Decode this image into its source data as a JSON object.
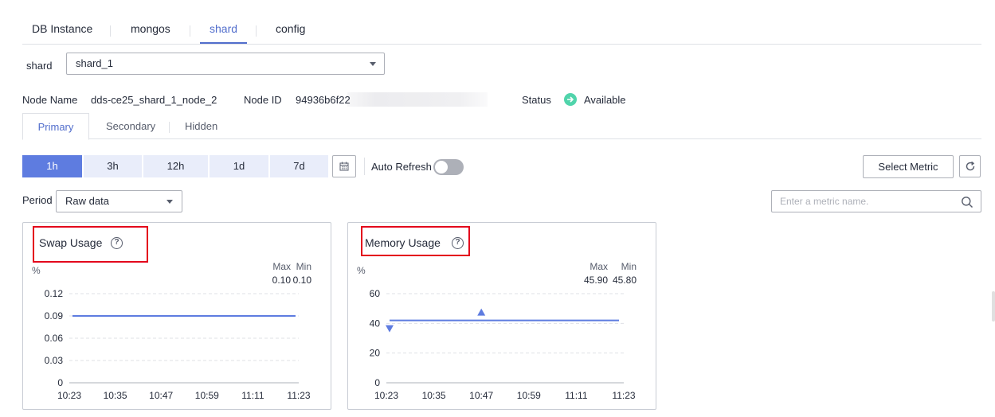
{
  "top_tabs": [
    {
      "label": "DB Instance",
      "active": false
    },
    {
      "label": "mongos",
      "active": false
    },
    {
      "label": "shard",
      "active": true
    },
    {
      "label": "config",
      "active": false
    }
  ],
  "shard_selector": {
    "label": "shard",
    "value": "shard_1"
  },
  "node_info": {
    "name_label": "Node Name",
    "name_value": "dds-ce25_shard_1_node_2",
    "id_label": "Node ID",
    "id_value": "94936b6f22",
    "status_label": "Status",
    "status_value": "Available",
    "status_color": "#50d4ab"
  },
  "sub_tabs": [
    {
      "label": "Primary",
      "active": true
    },
    {
      "label": "Secondary",
      "active": false
    },
    {
      "label": "Hidden",
      "active": false
    }
  ],
  "time_ranges": [
    {
      "label": "1h",
      "active": true
    },
    {
      "label": "3h",
      "active": false
    },
    {
      "label": "12h",
      "active": false
    },
    {
      "label": "1d",
      "active": false
    },
    {
      "label": "7d",
      "active": false
    }
  ],
  "auto_refresh": {
    "label": "Auto Refresh",
    "enabled": false
  },
  "select_metric_label": "Select Metric",
  "period": {
    "label": "Period",
    "value": "Raw data"
  },
  "search": {
    "placeholder": "Enter a metric name."
  },
  "accent_color": "#5e7ce0",
  "highlight_color": "#e3001b",
  "chart_data": [
    {
      "type": "line",
      "title": "Swap Usage",
      "unit": "%",
      "max_label": "Max",
      "min_label": "Min",
      "max_value": "0.10",
      "min_value": "0.10",
      "ylim": [
        0,
        0.12
      ],
      "y_ticks": [
        "0.12",
        "0.09",
        "0.06",
        "0.03",
        "0"
      ],
      "y_tick_values": [
        0.12,
        0.09,
        0.06,
        0.03,
        0
      ],
      "x_ticks": [
        "10:23",
        "10:35",
        "10:47",
        "10:59",
        "11:11",
        "11:23"
      ],
      "series": [
        {
          "values": [
            0.09,
            0.09
          ]
        }
      ],
      "grid": true
    },
    {
      "type": "line",
      "title": "Memory Usage",
      "unit": "%",
      "max_label": "Max",
      "min_label": "Min",
      "max_value": "45.90",
      "min_value": "45.80",
      "ylim": [
        0,
        60
      ],
      "y_ticks": [
        "60",
        "40",
        "20",
        "0"
      ],
      "y_tick_values": [
        60,
        40,
        20,
        0
      ],
      "x_ticks": [
        "10:23",
        "10:35",
        "10:47",
        "10:59",
        "11:11",
        "11:23"
      ],
      "series": [
        {
          "values": [
            42,
            42
          ]
        }
      ],
      "markers": {
        "max_at": "10:47",
        "min_at": "10:23"
      },
      "grid": true
    }
  ]
}
